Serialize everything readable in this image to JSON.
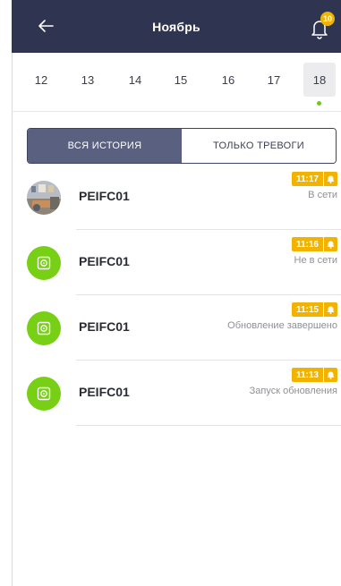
{
  "header": {
    "title": "Ноябрь",
    "notifications_count": "10"
  },
  "dates": {
    "items": [
      "12",
      "13",
      "14",
      "15",
      "16",
      "17",
      "18"
    ],
    "selected": "18"
  },
  "filter": {
    "all_label": "ВСЯ ИСТОРИЯ",
    "alarms_label": "ТОЛЬКО ТРЕВОГИ",
    "active": "all"
  },
  "events": [
    {
      "device": "PEIFC01",
      "time": "11:17",
      "status": "В сети",
      "icon": "camera-photo-avatar"
    },
    {
      "device": "PEIFC01",
      "time": "11:16",
      "status": "Не в сети",
      "icon": "device-icon"
    },
    {
      "device": "PEIFC01",
      "time": "11:15",
      "status": "Обновление завершено",
      "icon": "device-icon"
    },
    {
      "device": "PEIFC01",
      "time": "11:13",
      "status": "Запуск обновления",
      "icon": "device-icon"
    }
  ],
  "colors": {
    "header_bg": "#2f3550",
    "accent_green": "#77cf16",
    "badge_yellow": "#f2b300",
    "segment_active": "#5a6180"
  }
}
